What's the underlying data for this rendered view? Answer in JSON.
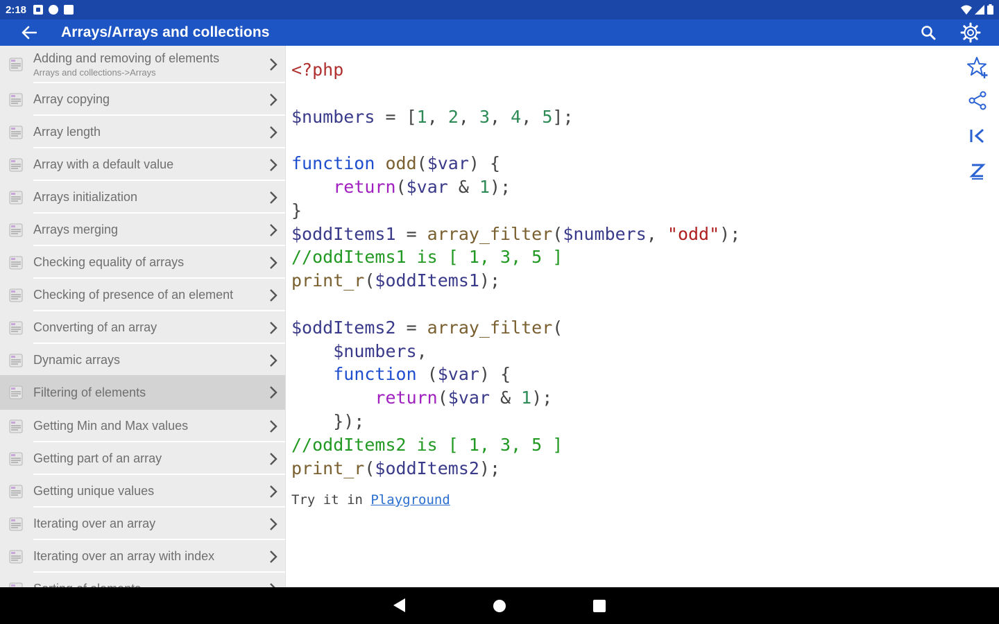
{
  "status_bar": {
    "time": "2:18"
  },
  "app_bar": {
    "title": "Arrays/Arrays and collections"
  },
  "sidebar": {
    "items": [
      {
        "label": "Adding and removing of elements",
        "sub": "Arrays and collections->Arrays"
      },
      {
        "label": "Array copying"
      },
      {
        "label": "Array length"
      },
      {
        "label": "Array with a default value"
      },
      {
        "label": "Arrays initialization"
      },
      {
        "label": "Arrays merging"
      },
      {
        "label": "Checking equality of arrays"
      },
      {
        "label": "Checking of presence of an element"
      },
      {
        "label": "Converting of an array"
      },
      {
        "label": "Dynamic arrays"
      },
      {
        "label": "Filtering of elements",
        "selected": true
      },
      {
        "label": "Getting Min and Max values"
      },
      {
        "label": "Getting part of an array"
      },
      {
        "label": "Getting unique values"
      },
      {
        "label": "Iterating over an array"
      },
      {
        "label": "Iterating over an array with index"
      },
      {
        "label": "Sorting of elements"
      }
    ]
  },
  "code": {
    "lines": [
      [
        {
          "t": "<?php",
          "c": "php"
        }
      ],
      [],
      [
        {
          "t": "$numbers",
          "c": "var"
        },
        {
          "t": " = [",
          "c": "pl"
        },
        {
          "t": "1",
          "c": "num"
        },
        {
          "t": ", ",
          "c": "pl"
        },
        {
          "t": "2",
          "c": "num"
        },
        {
          "t": ", ",
          "c": "pl"
        },
        {
          "t": "3",
          "c": "num"
        },
        {
          "t": ", ",
          "c": "pl"
        },
        {
          "t": "4",
          "c": "num"
        },
        {
          "t": ", ",
          "c": "pl"
        },
        {
          "t": "5",
          "c": "num"
        },
        {
          "t": "];",
          "c": "pl"
        }
      ],
      [],
      [
        {
          "t": "function",
          "c": "kw"
        },
        {
          "t": " ",
          "c": "pl"
        },
        {
          "t": "odd",
          "c": "fn"
        },
        {
          "t": "(",
          "c": "pl"
        },
        {
          "t": "$var",
          "c": "var"
        },
        {
          "t": ") {",
          "c": "pl"
        }
      ],
      [
        {
          "t": "    ",
          "c": "pl"
        },
        {
          "t": "return",
          "c": "ret"
        },
        {
          "t": "(",
          "c": "pl"
        },
        {
          "t": "$var",
          "c": "var"
        },
        {
          "t": " & ",
          "c": "pl"
        },
        {
          "t": "1",
          "c": "num"
        },
        {
          "t": ");",
          "c": "pl"
        }
      ],
      [
        {
          "t": "}",
          "c": "pl"
        }
      ],
      [
        {
          "t": "$oddItems1",
          "c": "var"
        },
        {
          "t": " = ",
          "c": "pl"
        },
        {
          "t": "array_filter",
          "c": "fn"
        },
        {
          "t": "(",
          "c": "pl"
        },
        {
          "t": "$numbers",
          "c": "var"
        },
        {
          "t": ", ",
          "c": "pl"
        },
        {
          "t": "\"odd\"",
          "c": "str"
        },
        {
          "t": ");",
          "c": "pl"
        }
      ],
      [
        {
          "t": "//oddItems1 is [ 1, 3, 5 ]",
          "c": "cm"
        }
      ],
      [
        {
          "t": "print_r",
          "c": "fn"
        },
        {
          "t": "(",
          "c": "pl"
        },
        {
          "t": "$oddItems1",
          "c": "var"
        },
        {
          "t": ");",
          "c": "pl"
        }
      ],
      [],
      [
        {
          "t": "$oddItems2",
          "c": "var"
        },
        {
          "t": " = ",
          "c": "pl"
        },
        {
          "t": "array_filter",
          "c": "fn"
        },
        {
          "t": "(",
          "c": "pl"
        }
      ],
      [
        {
          "t": "    ",
          "c": "pl"
        },
        {
          "t": "$numbers",
          "c": "var"
        },
        {
          "t": ",",
          "c": "pl"
        }
      ],
      [
        {
          "t": "    ",
          "c": "pl"
        },
        {
          "t": "function",
          "c": "kw"
        },
        {
          "t": " (",
          "c": "pl"
        },
        {
          "t": "$var",
          "c": "var"
        },
        {
          "t": ") {",
          "c": "pl"
        }
      ],
      [
        {
          "t": "        ",
          "c": "pl"
        },
        {
          "t": "return",
          "c": "ret"
        },
        {
          "t": "(",
          "c": "pl"
        },
        {
          "t": "$var",
          "c": "var"
        },
        {
          "t": " & ",
          "c": "pl"
        },
        {
          "t": "1",
          "c": "num"
        },
        {
          "t": ");",
          "c": "pl"
        }
      ],
      [
        {
          "t": "    });",
          "c": "pl"
        }
      ],
      [
        {
          "t": "//oddItems2 is [ 1, 3, 5 ]",
          "c": "cm"
        }
      ],
      [
        {
          "t": "print_r",
          "c": "fn"
        },
        {
          "t": "(",
          "c": "pl"
        },
        {
          "t": "$oddItems2",
          "c": "var"
        },
        {
          "t": ");",
          "c": "pl"
        }
      ]
    ]
  },
  "try_it": {
    "prefix": "Try it in ",
    "link": "Playground"
  },
  "colors": {
    "status_bar": "#1a47a8",
    "app_bar": "#1e55c4",
    "tool_icon": "#2a62d4"
  },
  "icons": {
    "back": "arrow-left-icon",
    "search": "search-icon",
    "settings": "gear-icon",
    "favorite": "star-add-icon",
    "share": "share-icon",
    "first": "skip-first-icon",
    "sort": "sort-z-icon"
  }
}
